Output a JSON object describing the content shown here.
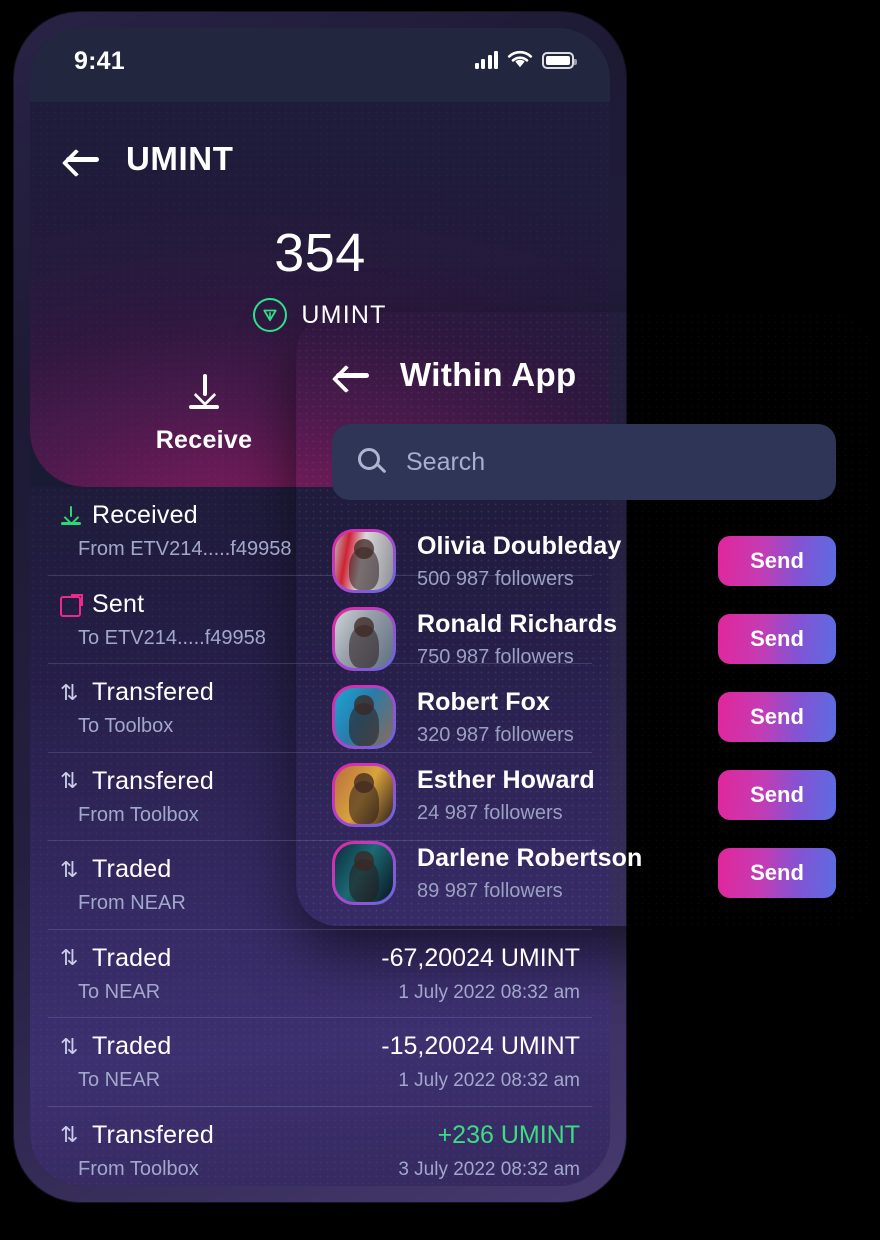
{
  "phone": {
    "status_bar": {
      "time": "9:41",
      "signal_icon": "cellular-signal-icon",
      "wifi_icon": "wifi-icon",
      "battery_icon": "battery-icon"
    },
    "header": {
      "back_icon": "back-arrow-icon",
      "title": "UMINT",
      "balance": "354",
      "coin_icon": "umint-coin-icon",
      "ticker": "UMINT",
      "receive_icon": "download-arrow-icon",
      "receive_label": "Receive"
    },
    "transactions": [
      {
        "icon": "download-green-icon",
        "type": "Received",
        "sub": "From ETV214.....f49958",
        "amount": "",
        "date": ""
      },
      {
        "icon": "external-link-pink-icon",
        "type": "Sent",
        "sub": "To ETV214.....f49958",
        "amount": "",
        "date": ""
      },
      {
        "icon": "swap-icon",
        "type": "Transfered",
        "sub": "To Toolbox",
        "amount": "",
        "date": ""
      },
      {
        "icon": "swap-icon",
        "type": "Transfered",
        "sub": "From Toolbox",
        "amount": "",
        "date": ""
      },
      {
        "icon": "swap-icon",
        "type": "Traded",
        "sub": "From NEAR",
        "amount": "",
        "date": ""
      },
      {
        "icon": "swap-icon",
        "type": "Traded",
        "sub": "To NEAR",
        "amount": "-67,20024 UMINT",
        "date": "1 July 2022 08:32 am"
      },
      {
        "icon": "swap-icon",
        "type": "Traded",
        "sub": "To NEAR",
        "amount": "-15,20024 UMINT",
        "date": "1 July 2022 08:32 am"
      },
      {
        "icon": "swap-icon",
        "type": "Transfered",
        "sub": "From Toolbox",
        "amount": "+236 UMINT",
        "date": "3 July 2022 08:32 am",
        "positive": true
      }
    ]
  },
  "modal": {
    "back_icon": "back-arrow-icon",
    "title": "Within App",
    "search": {
      "icon": "search-icon",
      "placeholder": "Search",
      "value": ""
    },
    "contacts": [
      {
        "name": "Olivia Doubleday",
        "followers": "500 987 followers",
        "send_label": "Send",
        "avatar": "avatar-olivia-doubleday"
      },
      {
        "name": "Ronald Richards",
        "followers": "750 987 followers",
        "send_label": "Send",
        "avatar": "avatar-ronald-richards"
      },
      {
        "name": "Robert Fox",
        "followers": "320 987 followers",
        "send_label": "Send",
        "avatar": "avatar-robert-fox"
      },
      {
        "name": "Esther Howard",
        "followers": "24 987 followers",
        "send_label": "Send",
        "avatar": "avatar-esther-howard"
      },
      {
        "name": "Darlene Robertson",
        "followers": "89 987 followers",
        "send_label": "Send",
        "avatar": "avatar-darlene-robertson"
      }
    ]
  },
  "colors": {
    "accent_pink": "#e2269b",
    "accent_blue": "#5a6de2",
    "positive_green": "#3ddc84",
    "coin_green": "#2fe08a",
    "modal_bg": "#1c1d36",
    "search_bg": "#2e3557"
  }
}
